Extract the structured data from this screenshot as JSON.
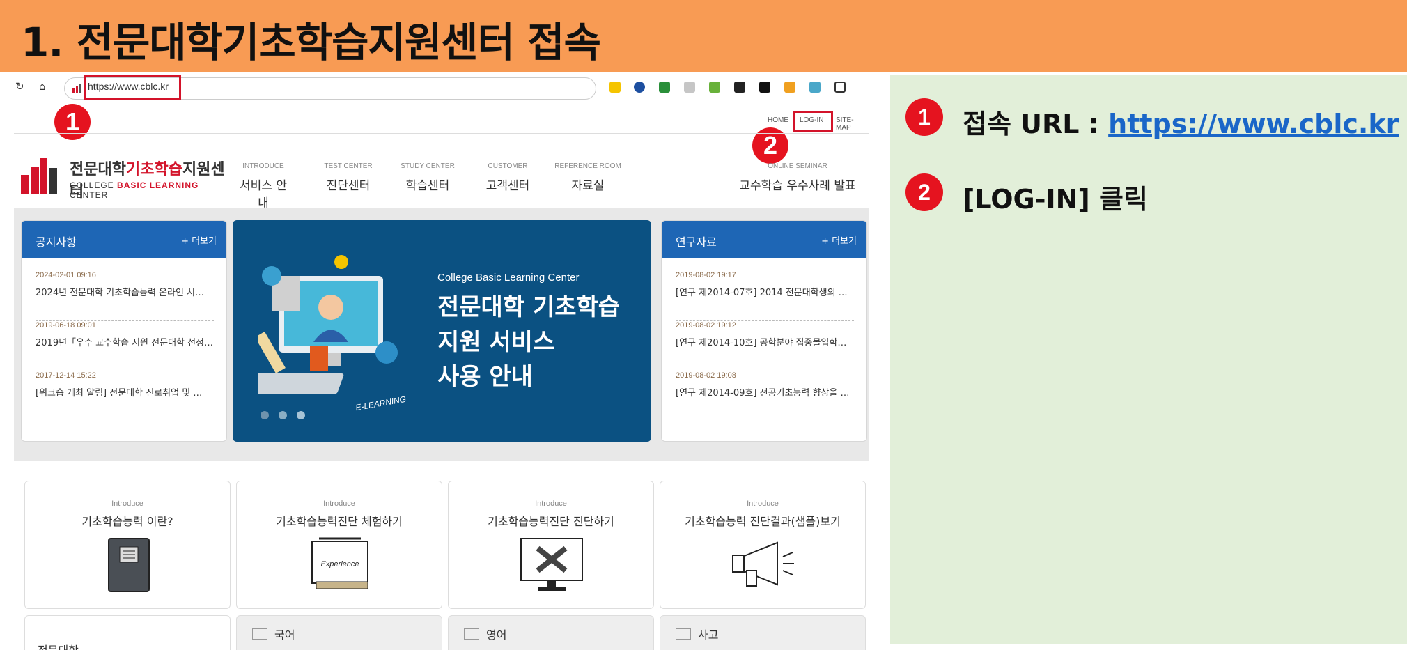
{
  "slide": {
    "title": "1. 전문대학기초학습지원센터 접속"
  },
  "browser": {
    "url": "https://www.cblc.kr"
  },
  "badges": [
    "1",
    "2"
  ],
  "site": {
    "util_links": [
      "HOME",
      "LOG-IN",
      "SITE-MAP"
    ],
    "logo": {
      "kr_a": "전문대학",
      "kr_b": "기초학습",
      "kr_c": "지원센터",
      "en_a": "COLLEGE ",
      "en_b": "BASIC LEARNING",
      "en_c": " CENTER",
      "mark": "cBLC"
    },
    "menu": [
      {
        "en": "INTRODUCE",
        "kr": "서비스 안내"
      },
      {
        "en": "TEST CENTER",
        "kr": "진단센터"
      },
      {
        "en": "STUDY CENTER",
        "kr": "학습센터"
      },
      {
        "en": "CUSTOMER",
        "kr": "고객센터"
      },
      {
        "en": "REFERENCE ROOM",
        "kr": "자료실"
      },
      {
        "en": "ONLINE SEMINAR",
        "kr": "교수학습 우수사례 발표"
      }
    ],
    "notices": {
      "title": "공지사항",
      "more": "+ 더보기",
      "items": [
        {
          "date": "2024-02-01 09:16",
          "text": "2024년 전문대학 기초학습능력 온라인 서…"
        },
        {
          "date": "2019-06-18 09:01",
          "text": "2019년「우수 교수학습 지원 전문대학 선정…"
        },
        {
          "date": "2017-12-14 15:22",
          "text": "[워크숍 개최 알림] 전문대학 진로취업 및 …"
        }
      ]
    },
    "banner": {
      "sub": "College Basic Learning Center",
      "line1": "전문대학 기초학습",
      "line2": "지원 서비스",
      "line3": "사용 안내",
      "tag": "E-LEARNING"
    },
    "research": {
      "title": "연구자료",
      "more": "+ 더보기",
      "items": [
        {
          "date": "2019-08-02 19:17",
          "text": "[연구 제2014-07호] 2014 전문대학생의 …"
        },
        {
          "date": "2019-08-02 19:12",
          "text": "[연구 제2014-10호] 공학분야 집중몰입학…"
        },
        {
          "date": "2019-08-02 19:08",
          "text": "[연구 제2014-09호] 전공기초능력 향상을 …"
        }
      ]
    },
    "cards": [
      {
        "intro": "Introduce",
        "title": "기초학습능력 이란?",
        "icon": "book-icon"
      },
      {
        "intro": "Introduce",
        "title": "기초학습능력진단 체험하기",
        "icon": "experience-scroll-icon",
        "icon_text": "Experience"
      },
      {
        "intro": "Introduce",
        "title": "기초학습능력진단 진단하기",
        "icon": "monitor-pencil-icon"
      },
      {
        "intro": "Introduce",
        "title": "기초학습능력 진단결과(샘플)보기",
        "icon": "megaphone-icon"
      }
    ],
    "bottom": {
      "first": "전문대학",
      "subjects": [
        "국어",
        "영어",
        "사고"
      ]
    }
  },
  "steps": [
    {
      "num": "1",
      "label": "접속 URL : ",
      "link": "https://www.cblc.kr"
    },
    {
      "num": "2",
      "label": "[LOG-IN] 클릭"
    }
  ],
  "colors": {
    "title_bar": "#f89b54",
    "accent_red": "#e5131f",
    "panel_blue": "#1e66b5",
    "banner_blue": "#0b5182",
    "right_panel": "#e2efd9"
  }
}
